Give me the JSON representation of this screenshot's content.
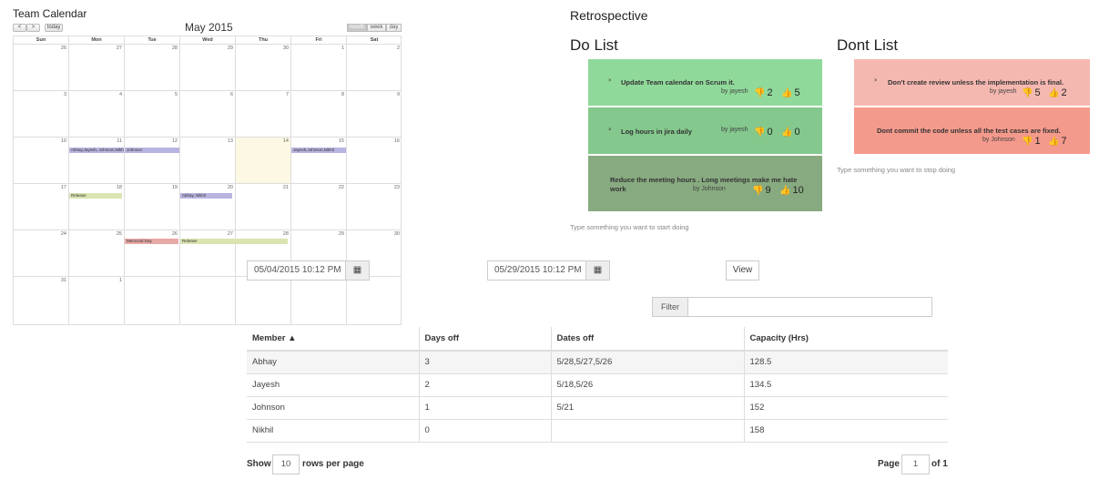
{
  "calendar": {
    "title": "Team Calendar",
    "month": "May 2015",
    "nav": {
      "prev": "<",
      "next": ">",
      "today": "today"
    },
    "views": [
      "month",
      "week",
      "day"
    ],
    "weekdays": [
      "Sun",
      "Mon",
      "Tue",
      "Wed",
      "Thu",
      "Fri",
      "Sat"
    ],
    "weeks": [
      [
        "26",
        "27",
        "28",
        "29",
        "30",
        "1",
        "2"
      ],
      [
        "3",
        "4",
        "5",
        "6",
        "7",
        "8",
        "9"
      ],
      [
        "10",
        "11",
        "12",
        "13",
        "14",
        "15",
        "16"
      ],
      [
        "17",
        "18",
        "19",
        "20",
        "21",
        "22",
        "23"
      ],
      [
        "24",
        "25",
        "26",
        "27",
        "28",
        "29",
        "30"
      ],
      [
        "31",
        "1",
        "",
        "",
        "",
        "",
        ""
      ]
    ],
    "events": [
      {
        "label": "Abhay,Jayesh, Johnson,Nikhil",
        "color": "#b8b4e0"
      },
      {
        "label": "Johnson",
        "color": "#b8b4e0"
      },
      {
        "label": "Jayesh,Johnson,Nikhil",
        "color": "#b8b4e0"
      },
      {
        "label": "Release",
        "color": "#d9e4b0"
      },
      {
        "label": "Abhay, Nikhil",
        "color": "#b8b4e0"
      },
      {
        "label": "Memorial Day",
        "color": "#e8a8a8"
      },
      {
        "label": "Release",
        "color": "#d9e4b0"
      }
    ]
  },
  "retro": {
    "title": "Retrospective",
    "do_title": "Do List",
    "dont_title": "Dont List",
    "do_items": [
      {
        "text": "Update Team calendar on Scrum it.",
        "by": "by jayesh",
        "down": "2",
        "up": "5"
      },
      {
        "text": "Log hours in jira daily",
        "by": "by jayesh",
        "down": "0",
        "up": "0"
      },
      {
        "text": "Reduce the meeting hours . Long meetings make me hate work",
        "by": "by Johnson",
        "down": "9",
        "up": "10"
      }
    ],
    "dont_items": [
      {
        "text": "Don't create review unless the implementation is final.",
        "by": "by jayesh",
        "down": "5",
        "up": "2"
      },
      {
        "text": "Dont commit the code unless all the test cases are fixed.",
        "by": "by Johnson",
        "down": "1",
        "up": "7"
      }
    ],
    "do_hint": "Type something you want to start doing",
    "dont_hint": "Type something you want to stop doing",
    "colors": {
      "do1": "#8fd99a",
      "do2": "#84c88d",
      "do3": "#88aa80",
      "dont1": "#f5b8b0",
      "dont2": "#f49a8c"
    }
  },
  "filters": {
    "start_date": "05/04/2015 10:12 PM",
    "end_date": "05/29/2015 10:12 PM",
    "view_label": "View",
    "filter_label": "Filter",
    "filter_value": ""
  },
  "table": {
    "headers": [
      "Member ▲",
      "Days off",
      "Dates off",
      "Capacity (Hrs)"
    ],
    "rows": [
      [
        "Abhay",
        "3",
        "5/28,5/27,5/26",
        "128.5"
      ],
      [
        "Jayesh",
        "2",
        "5/18,5/26",
        "134.5"
      ],
      [
        "Johnson",
        "1",
        "5/21",
        "152"
      ],
      [
        "Nikhil",
        "0",
        "",
        "158"
      ]
    ]
  },
  "pager": {
    "show": "Show",
    "rows_value": "10",
    "rows_per_page": "rows per page",
    "page": "Page",
    "page_value": "1",
    "of": "of 1"
  }
}
